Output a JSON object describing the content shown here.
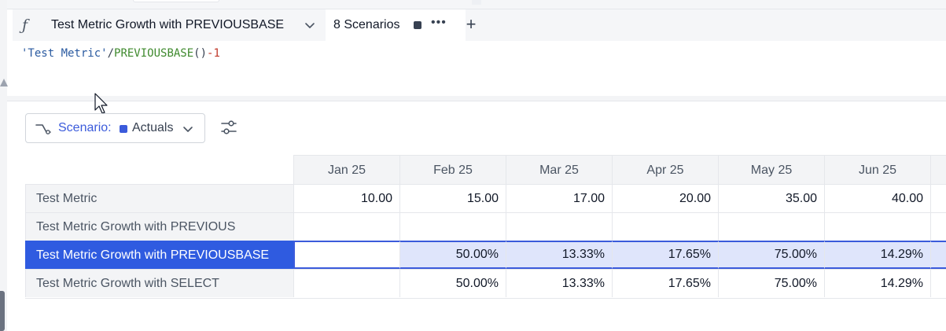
{
  "formula_bar": {
    "icon": "function-icon",
    "tab_title": "Test Metric Growth with PREVIOUSBASE",
    "scenarios_label": "8 Scenarios",
    "more_label": "•••",
    "add_label": "+",
    "formula_tokens": {
      "metric": "'Test Metric'",
      "op_divide": "/",
      "fn": "PREVIOUSBASE",
      "parens": "()",
      "op_minus": "-",
      "num": "1"
    }
  },
  "scenario_filter": {
    "prefix": "Scenario:",
    "value": "Actuals",
    "color": "#3b5bdb"
  },
  "grid": {
    "columns": [
      "Jan 25",
      "Feb 25",
      "Mar 25",
      "Apr 25",
      "May 25",
      "Jun 25"
    ],
    "rows": [
      {
        "label": "Test Metric",
        "values": [
          "10.00",
          "15.00",
          "17.00",
          "20.00",
          "35.00",
          "40.00"
        ]
      },
      {
        "label": "Test Metric Growth with PREVIOUS",
        "values": [
          "",
          "",
          "",
          "",
          "",
          ""
        ]
      },
      {
        "label": "Test Metric Growth with PREVIOUSBASE",
        "values": [
          "",
          "50.00%",
          "13.33%",
          "17.65%",
          "75.00%",
          "14.29%"
        ],
        "selected": true
      },
      {
        "label": "Test Metric Growth with SELECT",
        "values": [
          "",
          "50.00%",
          "13.33%",
          "17.65%",
          "75.00%",
          "14.29%"
        ]
      }
    ],
    "selection_color": "#2f5be0"
  }
}
